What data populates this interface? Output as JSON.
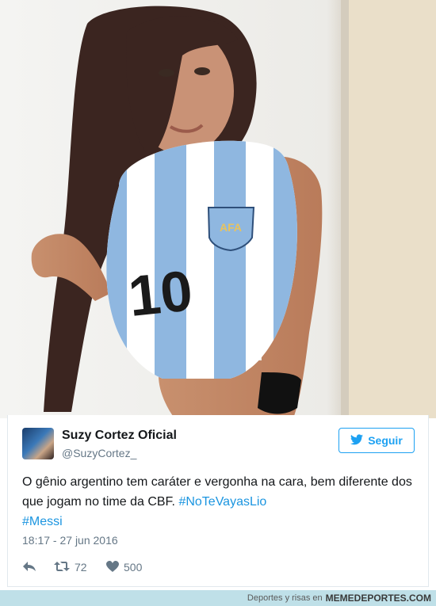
{
  "tweet": {
    "author_name": "Suzy Cortez Oficial",
    "author_handle": "@SuzyCortez_",
    "follow_label": "Seguir",
    "text_plain": "O gênio argentino tem caráter e vergonha na cara, bem diferente dos que jogam no time da CBF. ",
    "hashtag_1": "#NoTeVayasLio",
    "hashtag_2": "#Messi",
    "timestamp": "18:17 - 27 jun 2016",
    "retweets": "72",
    "likes": "500"
  },
  "photo": {
    "jersey_number": "10",
    "crest_text": "AFA"
  },
  "footer": {
    "prefix": "Deportes y risas en",
    "brand": "MEMEDEPORTES.COM"
  },
  "colors": {
    "accent": "#1da1f2",
    "hashtag": "#1b95e0",
    "muted": "#657786",
    "footer_bg": "#bfe0e8"
  },
  "icons": {
    "follow": "twitter-bird-icon",
    "reply": "reply-icon",
    "retweet": "retweet-icon",
    "like": "heart-icon"
  }
}
